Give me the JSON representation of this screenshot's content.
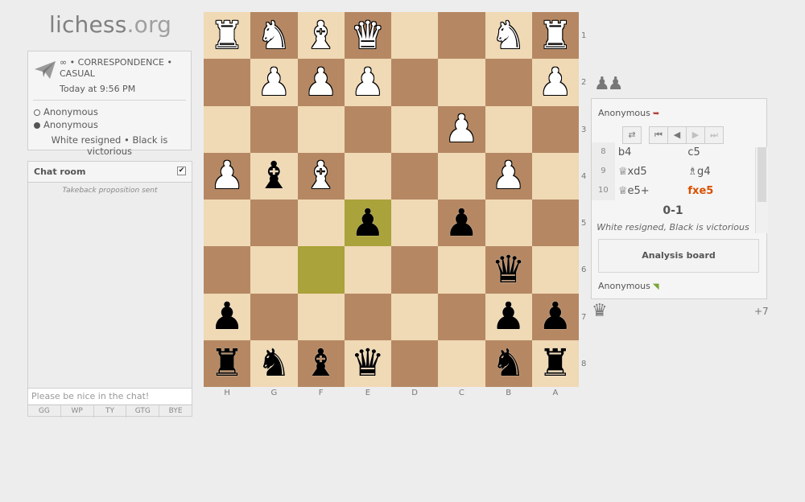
{
  "site": {
    "logo_main": "lichess",
    "logo_tld": ".org"
  },
  "game_info": {
    "setup": "∞ • CORRESPONDENCE • CASUAL",
    "date": "Today at 9:56 PM",
    "white_player": "Anonymous",
    "black_player": "Anonymous",
    "status": "White resigned • Black is victorious"
  },
  "chat": {
    "title": "Chat room",
    "checkbox": "✔",
    "messages": [
      "Takeback proposition sent"
    ],
    "placeholder": "Please be nice in the chat!",
    "presets": [
      "GG",
      "WP",
      "TY",
      "GTG",
      "BYE"
    ]
  },
  "board": {
    "ranks": [
      [
        "♜",
        "♞",
        "♝",
        "♛",
        "",
        "",
        "♞",
        "♜"
      ],
      [
        "",
        "♟",
        "♟",
        "♟",
        "",
        "",
        "",
        "♟"
      ],
      [
        "",
        "",
        "",
        "",
        "",
        "♟",
        "",
        ""
      ],
      [
        "♟",
        "♝",
        "♝",
        "",
        "",
        "",
        "♟",
        ""
      ],
      [
        "",
        "",
        "",
        "♟",
        "",
        "♟",
        "",
        ""
      ],
      [
        "",
        "",
        "",
        "",
        "",
        "",
        "♛",
        ""
      ],
      [
        "♟",
        "",
        "",
        "",
        "",
        "",
        "♟",
        "♟"
      ],
      [
        "♜",
        "♞",
        "♝",
        "♛",
        "",
        "",
        "♞",
        "♜"
      ]
    ],
    "colors": [
      [
        "w",
        "w",
        "w",
        "w",
        "",
        "",
        "w",
        "w"
      ],
      [
        "",
        "w",
        "w",
        "w",
        "",
        "",
        "",
        "w"
      ],
      [
        "",
        "",
        "",
        "",
        "",
        "w",
        "",
        ""
      ],
      [
        "w",
        "b",
        "w",
        "",
        "",
        "",
        "w",
        ""
      ],
      [
        "",
        "",
        "",
        "b",
        "",
        "b",
        "",
        ""
      ],
      [
        "",
        "",
        "",
        "",
        "",
        "",
        "b",
        ""
      ],
      [
        "b",
        "",
        "",
        "",
        "",
        "",
        "b",
        "b"
      ],
      [
        "b",
        "b",
        "b",
        "b",
        "",
        "",
        "b",
        "b"
      ]
    ],
    "highlight": [
      "4-3",
      "5-2"
    ],
    "rank_labels": [
      "1",
      "2",
      "3",
      "4",
      "5",
      "6",
      "7",
      "8"
    ],
    "file_labels": [
      "H",
      "G",
      "F",
      "E",
      "D",
      "C",
      "B",
      "A"
    ],
    "light_color": "#f0d9b5",
    "dark_color": "#b58863",
    "highlight_color": "#aaa23a"
  },
  "captured": {
    "top": "♟♟",
    "bottom": "♛",
    "material": "+7"
  },
  "side": {
    "top_player": "Anonymous",
    "bottom_player": "Anonymous",
    "nav": {
      "flip": "⇄",
      "first": "⏮",
      "prev": "◀",
      "next": "▶",
      "last": "⏭"
    },
    "moves": [
      {
        "num": "8",
        "white": "b4",
        "black": "c5",
        "active": false
      },
      {
        "num": "9",
        "white": "♕xd5",
        "black": "♗g4",
        "active": false
      },
      {
        "num": "10",
        "white": "♕e5+",
        "black": "fxe5",
        "active": true
      }
    ],
    "result": "0-1",
    "result_text": "White resigned, Black is victorious",
    "analysis_button": "Analysis board"
  }
}
